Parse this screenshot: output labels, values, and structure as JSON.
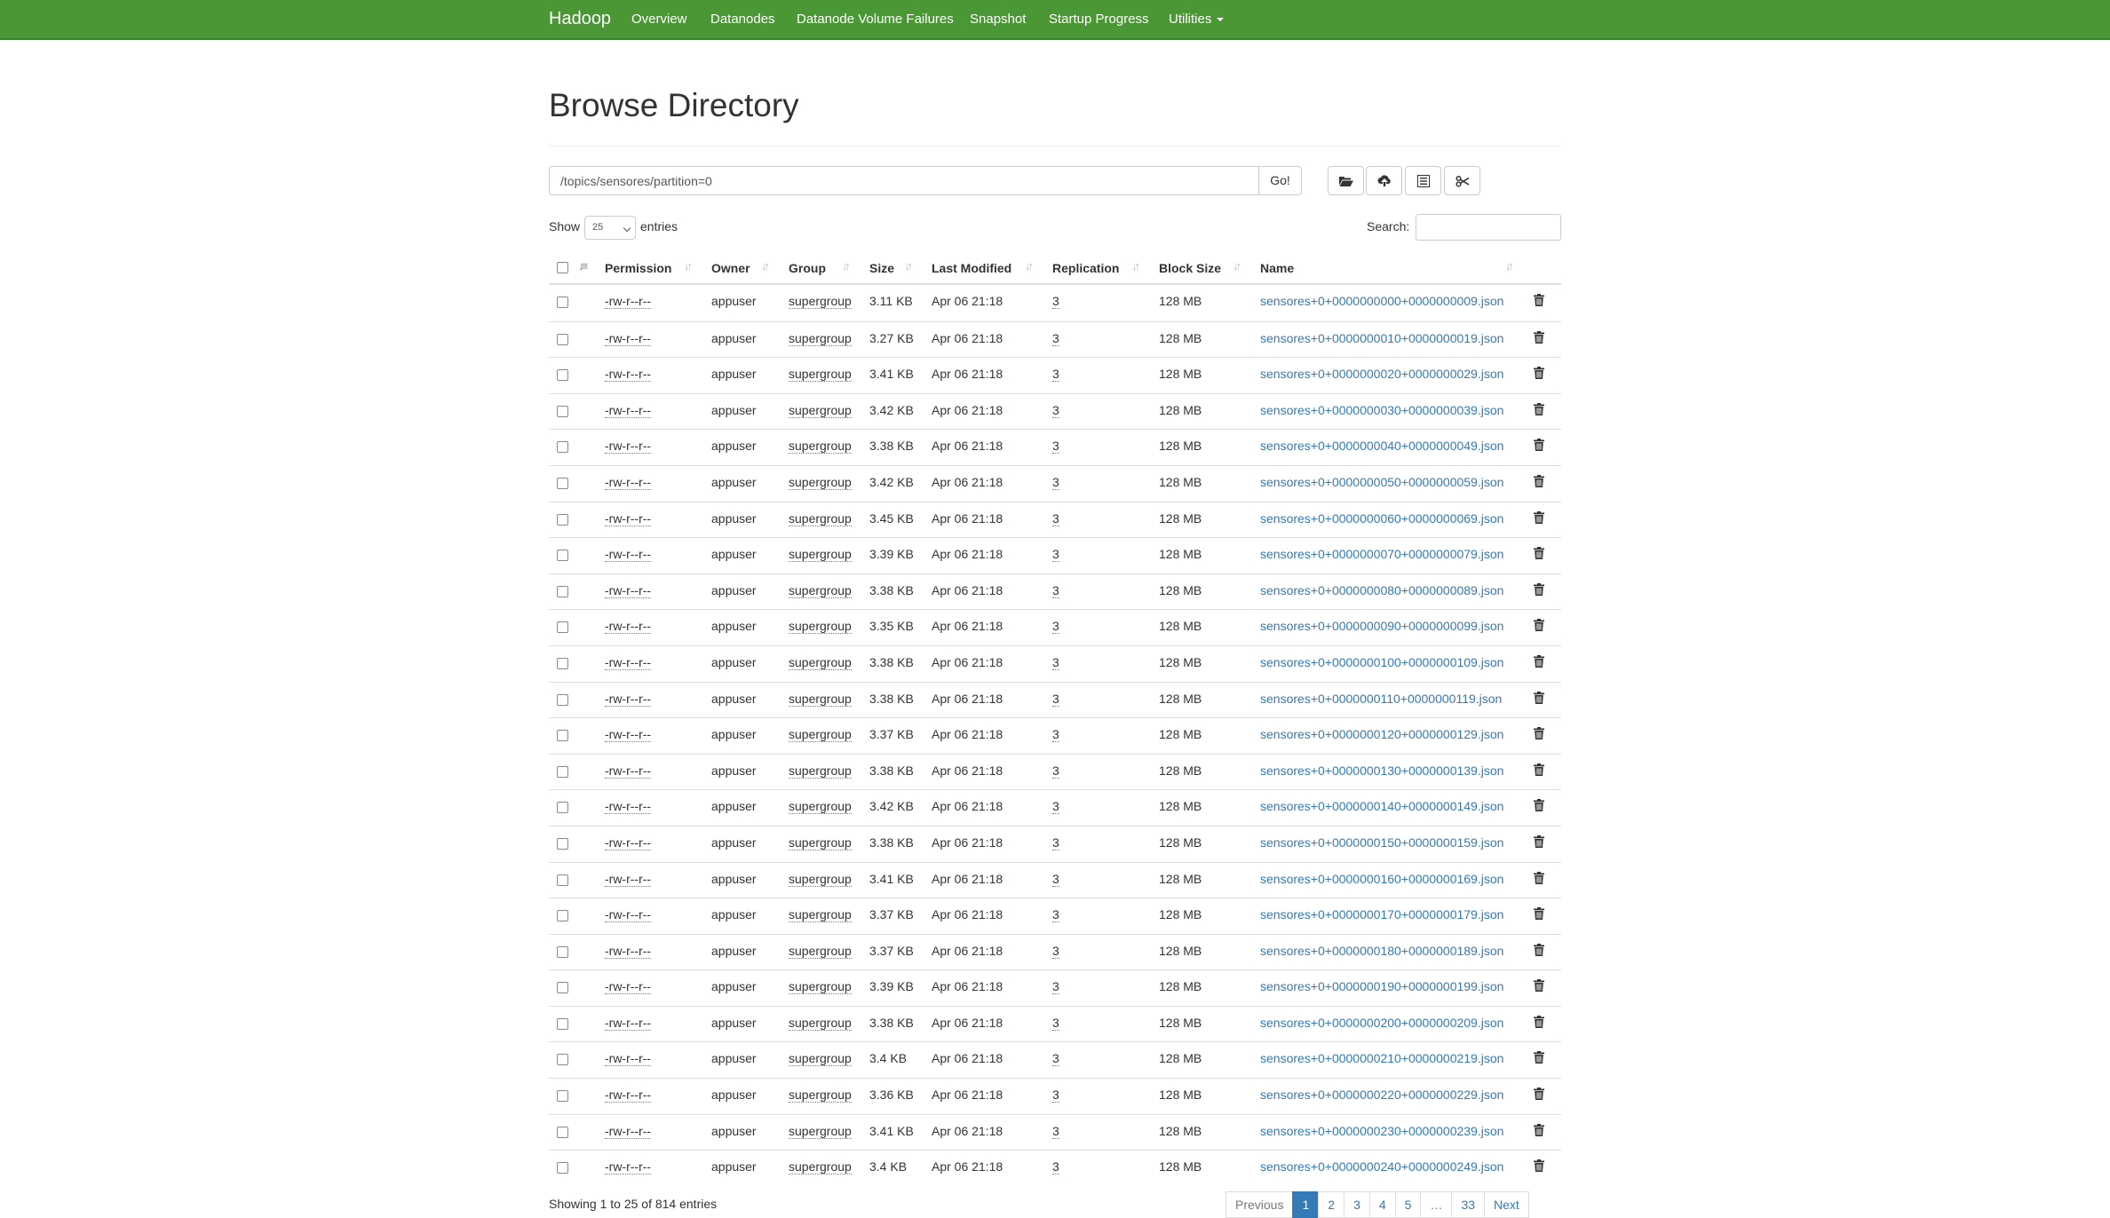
{
  "navbar": {
    "brand": "Hadoop",
    "items": [
      "Overview",
      "Datanodes",
      "Datanode Volume Failures",
      "Snapshot",
      "Startup Progress",
      "Utilities"
    ]
  },
  "page_title": "Browse Directory",
  "path_value": "/topics/sensores/partition=0",
  "go_label": "Go!",
  "toolbar_icons": [
    "folder-open-icon",
    "cloud-upload-icon",
    "list-alt-icon",
    "scissors-icon"
  ],
  "length": {
    "show": "Show",
    "value": "25",
    "entries": "entries"
  },
  "search_label": "Search:",
  "columns": [
    "Permission",
    "Owner",
    "Group",
    "Size",
    "Last Modified",
    "Replication",
    "Block Size",
    "Name"
  ],
  "rows": [
    {
      "perm": "-rw-r--r--",
      "owner": "appuser",
      "group": "supergroup",
      "size": "3.11 KB",
      "modified": "Apr 06 21:18",
      "replication": "3",
      "block": "128 MB",
      "name": "sensores+0+0000000000+0000000009.json"
    },
    {
      "perm": "-rw-r--r--",
      "owner": "appuser",
      "group": "supergroup",
      "size": "3.27 KB",
      "modified": "Apr 06 21:18",
      "replication": "3",
      "block": "128 MB",
      "name": "sensores+0+0000000010+0000000019.json"
    },
    {
      "perm": "-rw-r--r--",
      "owner": "appuser",
      "group": "supergroup",
      "size": "3.41 KB",
      "modified": "Apr 06 21:18",
      "replication": "3",
      "block": "128 MB",
      "name": "sensores+0+0000000020+0000000029.json"
    },
    {
      "perm": "-rw-r--r--",
      "owner": "appuser",
      "group": "supergroup",
      "size": "3.42 KB",
      "modified": "Apr 06 21:18",
      "replication": "3",
      "block": "128 MB",
      "name": "sensores+0+0000000030+0000000039.json"
    },
    {
      "perm": "-rw-r--r--",
      "owner": "appuser",
      "group": "supergroup",
      "size": "3.38 KB",
      "modified": "Apr 06 21:18",
      "replication": "3",
      "block": "128 MB",
      "name": "sensores+0+0000000040+0000000049.json"
    },
    {
      "perm": "-rw-r--r--",
      "owner": "appuser",
      "group": "supergroup",
      "size": "3.42 KB",
      "modified": "Apr 06 21:18",
      "replication": "3",
      "block": "128 MB",
      "name": "sensores+0+0000000050+0000000059.json"
    },
    {
      "perm": "-rw-r--r--",
      "owner": "appuser",
      "group": "supergroup",
      "size": "3.45 KB",
      "modified": "Apr 06 21:18",
      "replication": "3",
      "block": "128 MB",
      "name": "sensores+0+0000000060+0000000069.json"
    },
    {
      "perm": "-rw-r--r--",
      "owner": "appuser",
      "group": "supergroup",
      "size": "3.39 KB",
      "modified": "Apr 06 21:18",
      "replication": "3",
      "block": "128 MB",
      "name": "sensores+0+0000000070+0000000079.json"
    },
    {
      "perm": "-rw-r--r--",
      "owner": "appuser",
      "group": "supergroup",
      "size": "3.38 KB",
      "modified": "Apr 06 21:18",
      "replication": "3",
      "block": "128 MB",
      "name": "sensores+0+0000000080+0000000089.json"
    },
    {
      "perm": "-rw-r--r--",
      "owner": "appuser",
      "group": "supergroup",
      "size": "3.35 KB",
      "modified": "Apr 06 21:18",
      "replication": "3",
      "block": "128 MB",
      "name": "sensores+0+0000000090+0000000099.json"
    },
    {
      "perm": "-rw-r--r--",
      "owner": "appuser",
      "group": "supergroup",
      "size": "3.38 KB",
      "modified": "Apr 06 21:18",
      "replication": "3",
      "block": "128 MB",
      "name": "sensores+0+0000000100+0000000109.json"
    },
    {
      "perm": "-rw-r--r--",
      "owner": "appuser",
      "group": "supergroup",
      "size": "3.38 KB",
      "modified": "Apr 06 21:18",
      "replication": "3",
      "block": "128 MB",
      "name": "sensores+0+0000000110+0000000119.json"
    },
    {
      "perm": "-rw-r--r--",
      "owner": "appuser",
      "group": "supergroup",
      "size": "3.37 KB",
      "modified": "Apr 06 21:18",
      "replication": "3",
      "block": "128 MB",
      "name": "sensores+0+0000000120+0000000129.json"
    },
    {
      "perm": "-rw-r--r--",
      "owner": "appuser",
      "group": "supergroup",
      "size": "3.38 KB",
      "modified": "Apr 06 21:18",
      "replication": "3",
      "block": "128 MB",
      "name": "sensores+0+0000000130+0000000139.json"
    },
    {
      "perm": "-rw-r--r--",
      "owner": "appuser",
      "group": "supergroup",
      "size": "3.42 KB",
      "modified": "Apr 06 21:18",
      "replication": "3",
      "block": "128 MB",
      "name": "sensores+0+0000000140+0000000149.json"
    },
    {
      "perm": "-rw-r--r--",
      "owner": "appuser",
      "group": "supergroup",
      "size": "3.38 KB",
      "modified": "Apr 06 21:18",
      "replication": "3",
      "block": "128 MB",
      "name": "sensores+0+0000000150+0000000159.json"
    },
    {
      "perm": "-rw-r--r--",
      "owner": "appuser",
      "group": "supergroup",
      "size": "3.41 KB",
      "modified": "Apr 06 21:18",
      "replication": "3",
      "block": "128 MB",
      "name": "sensores+0+0000000160+0000000169.json"
    },
    {
      "perm": "-rw-r--r--",
      "owner": "appuser",
      "group": "supergroup",
      "size": "3.37 KB",
      "modified": "Apr 06 21:18",
      "replication": "3",
      "block": "128 MB",
      "name": "sensores+0+0000000170+0000000179.json"
    },
    {
      "perm": "-rw-r--r--",
      "owner": "appuser",
      "group": "supergroup",
      "size": "3.37 KB",
      "modified": "Apr 06 21:18",
      "replication": "3",
      "block": "128 MB",
      "name": "sensores+0+0000000180+0000000189.json"
    },
    {
      "perm": "-rw-r--r--",
      "owner": "appuser",
      "group": "supergroup",
      "size": "3.39 KB",
      "modified": "Apr 06 21:18",
      "replication": "3",
      "block": "128 MB",
      "name": "sensores+0+0000000190+0000000199.json"
    },
    {
      "perm": "-rw-r--r--",
      "owner": "appuser",
      "group": "supergroup",
      "size": "3.38 KB",
      "modified": "Apr 06 21:18",
      "replication": "3",
      "block": "128 MB",
      "name": "sensores+0+0000000200+0000000209.json"
    },
    {
      "perm": "-rw-r--r--",
      "owner": "appuser",
      "group": "supergroup",
      "size": "3.4 KB",
      "modified": "Apr 06 21:18",
      "replication": "3",
      "block": "128 MB",
      "name": "sensores+0+0000000210+0000000219.json"
    },
    {
      "perm": "-rw-r--r--",
      "owner": "appuser",
      "group": "supergroup",
      "size": "3.36 KB",
      "modified": "Apr 06 21:18",
      "replication": "3",
      "block": "128 MB",
      "name": "sensores+0+0000000220+0000000229.json"
    },
    {
      "perm": "-rw-r--r--",
      "owner": "appuser",
      "group": "supergroup",
      "size": "3.41 KB",
      "modified": "Apr 06 21:18",
      "replication": "3",
      "block": "128 MB",
      "name": "sensores+0+0000000230+0000000239.json"
    },
    {
      "perm": "-rw-r--r--",
      "owner": "appuser",
      "group": "supergroup",
      "size": "3.4 KB",
      "modified": "Apr 06 21:18",
      "replication": "3",
      "block": "128 MB",
      "name": "sensores+0+0000000240+0000000249.json"
    }
  ],
  "info": "Showing 1 to 25 of 814 entries",
  "pagination": {
    "previous": "Previous",
    "pages": [
      "1",
      "2",
      "3",
      "4",
      "5",
      "…",
      "33"
    ],
    "active": "1",
    "next": "Next"
  },
  "colors": {
    "navbar": "#4b9635",
    "link": "#337ab7"
  }
}
